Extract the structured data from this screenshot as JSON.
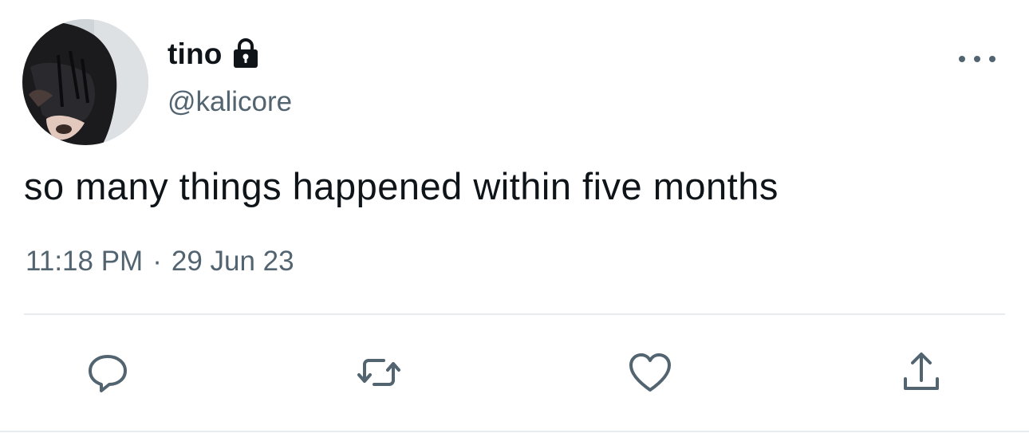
{
  "user": {
    "display_name": "tino",
    "handle": "@kalicore",
    "protected": true,
    "lock_icon": "lock-icon",
    "avatar": "profile-photo"
  },
  "tweet": {
    "text": "so many things happened within five months",
    "time": "11:18 PM",
    "separator": "·",
    "date": "29 Jun 23"
  },
  "actions": [
    {
      "name": "reply",
      "icon": "reply-icon"
    },
    {
      "name": "retweet",
      "icon": "retweet-icon"
    },
    {
      "name": "like",
      "icon": "heart-icon"
    },
    {
      "name": "share",
      "icon": "share-icon"
    }
  ],
  "colors": {
    "text_primary": "#0f1419",
    "text_secondary": "#536471",
    "divider": "#e6ecf0",
    "icon": "#536471"
  }
}
